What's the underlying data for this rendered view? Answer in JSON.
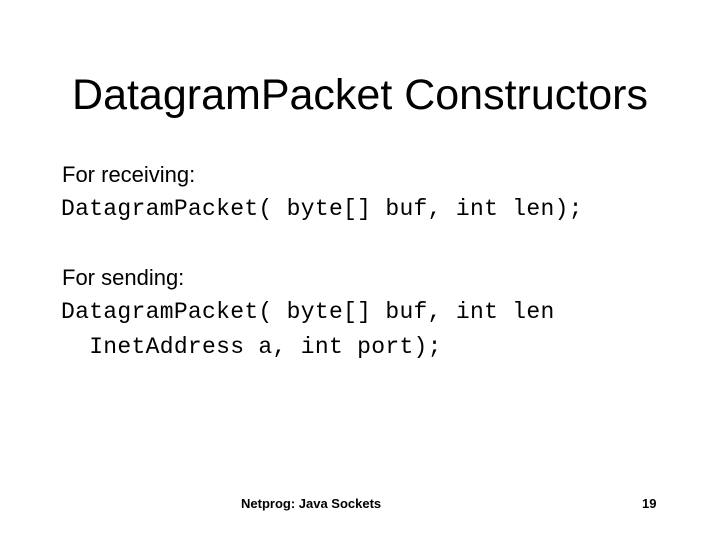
{
  "slide": {
    "title": "DatagramPacket Constructors",
    "sections": [
      {
        "label": "For receiving:",
        "code_lines": [
          "DatagramPacket( byte[] buf, int len);"
        ]
      },
      {
        "label": "For sending:",
        "code_lines": [
          "DatagramPacket( byte[] buf, int len",
          "  InetAddress a, int port);"
        ]
      }
    ],
    "footer": {
      "course": "Netprog: Java Sockets",
      "page_number": "19"
    }
  }
}
